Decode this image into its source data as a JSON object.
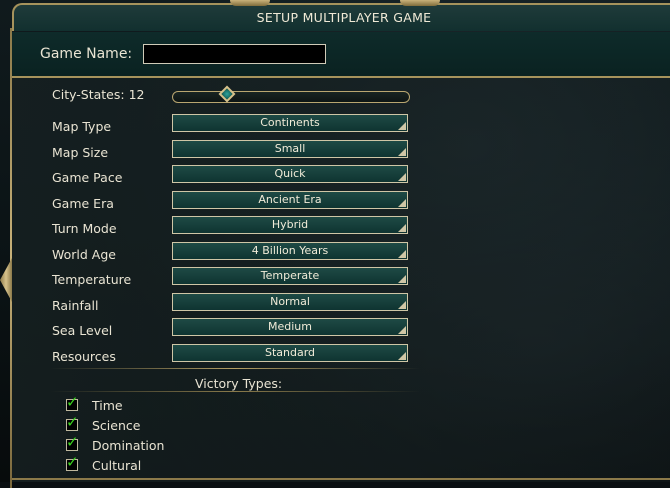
{
  "title": "SETUP MULTIPLAYER GAME",
  "game_name": {
    "label": "Game Name:",
    "value": ""
  },
  "city_states": {
    "label": "City-States: 12",
    "value": 12,
    "slider_fraction": 0.22
  },
  "settings": [
    {
      "label": "Map Type",
      "value": "Continents"
    },
    {
      "label": "Map Size",
      "value": "Small"
    },
    {
      "label": "Game Pace",
      "value": "Quick"
    },
    {
      "label": "Game Era",
      "value": "Ancient Era"
    },
    {
      "label": "Turn Mode",
      "value": "Hybrid"
    },
    {
      "label": "World Age",
      "value": "4 Billion Years"
    },
    {
      "label": "Temperature",
      "value": "Temperate"
    },
    {
      "label": "Rainfall",
      "value": "Normal"
    },
    {
      "label": "Sea Level",
      "value": "Medium"
    },
    {
      "label": "Resources",
      "value": "Standard"
    }
  ],
  "victory": {
    "title": "Victory Types:",
    "items": [
      {
        "label": "Time",
        "checked": true
      },
      {
        "label": "Science",
        "checked": true
      },
      {
        "label": "Domination",
        "checked": true
      },
      {
        "label": "Cultural",
        "checked": true
      }
    ]
  },
  "colors": {
    "accent_gold": "#b49e63",
    "teal_panel": "#1e4a45",
    "check_green": "#39d01d"
  }
}
